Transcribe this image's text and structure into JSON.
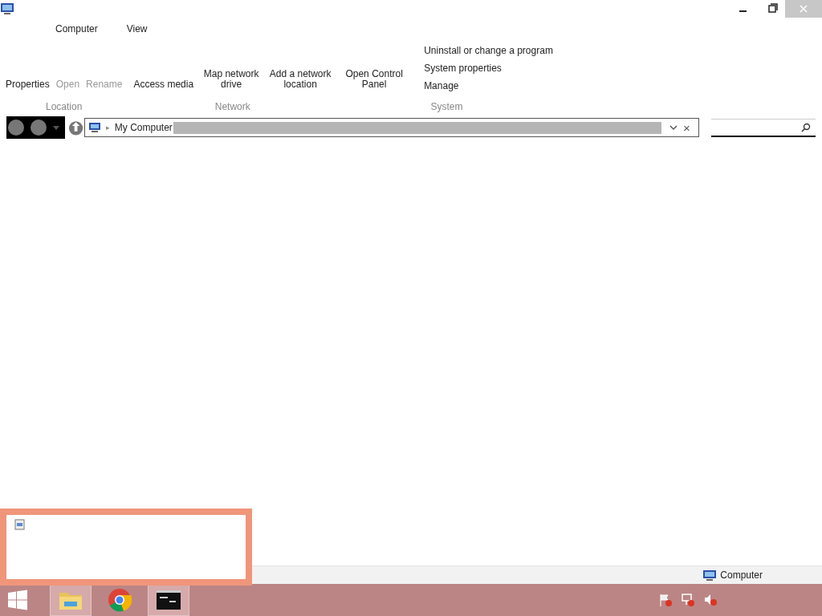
{
  "ribbon_tabs": [
    {
      "label": "Computer"
    },
    {
      "label": "View"
    }
  ],
  "ribbon_groups": [
    {
      "label": "Location",
      "buttons": [
        {
          "kind": "large",
          "label": "Properties",
          "disabled": false
        },
        {
          "kind": "large",
          "label": "Open",
          "disabled": true
        },
        {
          "kind": "large",
          "label": "Rename",
          "disabled": true
        }
      ]
    },
    {
      "label": "Network",
      "buttons": [
        {
          "kind": "large",
          "label": "Access media",
          "disabled": false
        },
        {
          "kind": "large",
          "label": "Map network drive",
          "disabled": false
        },
        {
          "kind": "large",
          "label": "Add a network location",
          "disabled": false
        }
      ]
    },
    {
      "label": "System",
      "buttons": [
        {
          "kind": "large",
          "label": "Open Control Panel",
          "disabled": false
        },
        {
          "kind": "small",
          "label": "Uninstall or change a program",
          "disabled": false
        },
        {
          "kind": "small",
          "label": "System properties",
          "disabled": false
        },
        {
          "kind": "small",
          "label": "Manage",
          "disabled": false
        }
      ]
    }
  ],
  "address_bar": {
    "separator": "▸",
    "path": "My Computer",
    "close": "×"
  },
  "status_bar": {
    "location": "Computer"
  },
  "taskbar": {
    "apps": [
      {
        "kind": "explorer",
        "selected": true
      },
      {
        "kind": "chrome",
        "selected": false
      },
      {
        "kind": "terminal",
        "selected": true
      }
    ]
  }
}
